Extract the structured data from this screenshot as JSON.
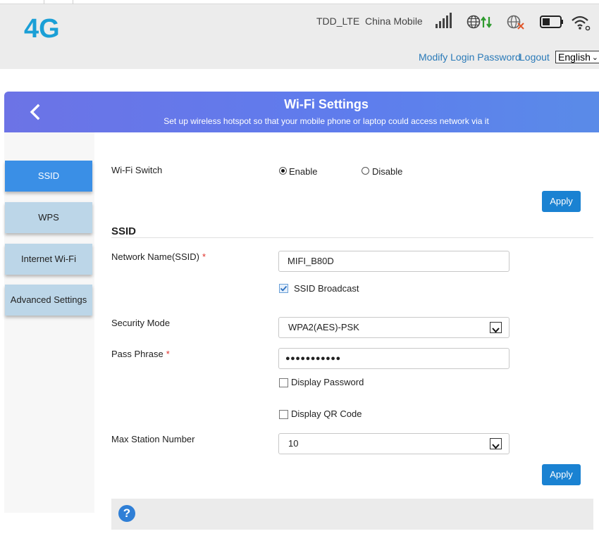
{
  "header": {
    "logo": "4G",
    "network_type": "TDD_LTE",
    "carrier": "China Mobile",
    "modify_password": "Modify Login Password",
    "logout": "Logout",
    "language": "English"
  },
  "banner": {
    "title": "Wi-Fi Settings",
    "subtitle": "Set up wireless hotspot so that your mobile phone or laptop could access network via it"
  },
  "sidebar": {
    "items": [
      {
        "label": "SSID",
        "active": true
      },
      {
        "label": "WPS",
        "active": false
      },
      {
        "label": "Internet Wi-Fi",
        "active": false
      },
      {
        "label": "Advanced Settings",
        "active": false
      }
    ]
  },
  "wifi_switch": {
    "label": "Wi-Fi Switch",
    "enable": "Enable",
    "disable": "Disable",
    "selected": "Enable"
  },
  "apply_label": "Apply",
  "ssid_section": {
    "title": "SSID",
    "network_name_label": "Network Name(SSID)",
    "network_name_value": "MIFI_B80D",
    "ssid_broadcast": "SSID Broadcast",
    "ssid_broadcast_checked": true,
    "security_mode_label": "Security Mode",
    "security_mode_value": "WPA2(AES)-PSK",
    "pass_phrase_label": "Pass Phrase",
    "pass_phrase_masked": "●●●●●●●●●●●",
    "display_password": "Display Password",
    "display_password_checked": false,
    "display_qr": "Display QR Code",
    "display_qr_checked": false,
    "max_station_label": "Max Station Number",
    "max_station_value": "10"
  },
  "required_mark": "*",
  "help_icon_glyph": "?",
  "icons": [
    "signal-icon",
    "globe-data-icon",
    "globe-off-icon",
    "battery-icon",
    "wifi-icon",
    "back-icon",
    "help-icon"
  ],
  "colors": {
    "brand": "#1a9fd6",
    "banner_start": "#6c73e6",
    "active_tab": "#3a8fe6",
    "inactive_tab": "#bcd6e8",
    "apply": "#1a82d2",
    "required": "#e0302a"
  }
}
